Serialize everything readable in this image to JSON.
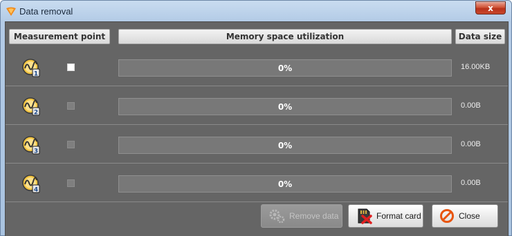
{
  "window": {
    "title": "Data removal",
    "title_icon": "app-logo-icon",
    "close_glyph": "x"
  },
  "table": {
    "headers": {
      "measurement_point": "Measurement point",
      "memory_utilization": "Memory space utilization",
      "data_size": "Data size"
    },
    "rows": [
      {
        "point": "1",
        "icon": "measurement-point-icon",
        "checkbox_enabled": true,
        "utilization_percent": 0,
        "utilization_label": "0%",
        "size": "16.00KB"
      },
      {
        "point": "2",
        "icon": "measurement-point-icon",
        "checkbox_enabled": false,
        "utilization_percent": 0,
        "utilization_label": "0%",
        "size": "0.00B"
      },
      {
        "point": "3",
        "icon": "measurement-point-icon",
        "checkbox_enabled": false,
        "utilization_percent": 0,
        "utilization_label": "0%",
        "size": "0.00B"
      },
      {
        "point": "4",
        "icon": "measurement-point-icon",
        "checkbox_enabled": false,
        "utilization_percent": 0,
        "utilization_label": "0%",
        "size": "0.00B"
      }
    ]
  },
  "buttons": {
    "remove_data": {
      "label": "Remove data",
      "icon": "gears-icon",
      "enabled": false
    },
    "format_card": {
      "label": "Format card",
      "icon": "memory-card-delete-icon",
      "enabled": true
    },
    "close": {
      "label": "Close",
      "icon": "cancel-circle-icon",
      "enabled": true
    }
  },
  "colors": {
    "panel_bg": "#656565",
    "progress_track": "#787878",
    "title_bar": "#b3cbe6",
    "close_button": "#c9482c"
  }
}
